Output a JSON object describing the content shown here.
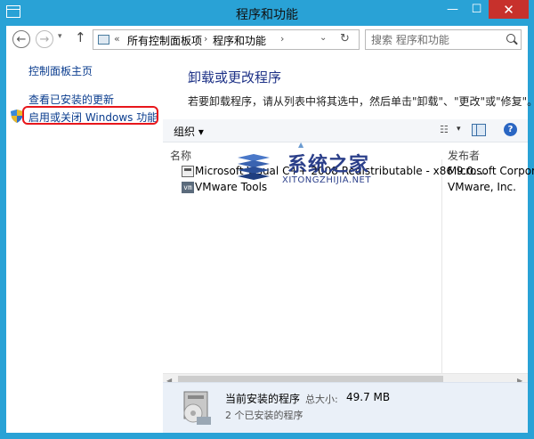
{
  "window": {
    "title": "程序和功能",
    "minimize": "—",
    "maximize": "☐",
    "close": "✕"
  },
  "address": {
    "back": "←",
    "forward": "→",
    "up": "↑",
    "sep1": "«",
    "crumb1": "所有控制面板项",
    "sep2": "›",
    "crumb2": "程序和功能",
    "sep3": "›",
    "dropdown": "⌄",
    "refresh": "↻",
    "search_placeholder": "搜索 程序和功能"
  },
  "sidebar": {
    "home": "控制面板主页",
    "updates": "查看已安装的更新",
    "features": "启用或关闭 Windows 功能"
  },
  "main": {
    "title": "卸载或更改程序",
    "description": "若要卸载程序，请从列表中将其选中，然后单击\"卸载\"、\"更改\"或\"修复\"。"
  },
  "toolbar": {
    "organize": "组织 ▾",
    "help": "?"
  },
  "columns": {
    "name": "名称",
    "publisher": "发布者"
  },
  "programs": [
    {
      "name": "Microsoft Visual C++ 2008 Redistributable - x86 9.0....",
      "publisher": "Microsoft Corpor"
    },
    {
      "name": "VMware Tools",
      "publisher": "VMware, Inc.",
      "icon": "vm"
    }
  ],
  "details": {
    "title": "当前安装的程序",
    "size_label": "总大小:",
    "size": "49.7 MB",
    "count": "2 个已安装的程序"
  },
  "watermark": {
    "text": "系统之家",
    "sub": "XITONGZHIJIA.NET"
  }
}
